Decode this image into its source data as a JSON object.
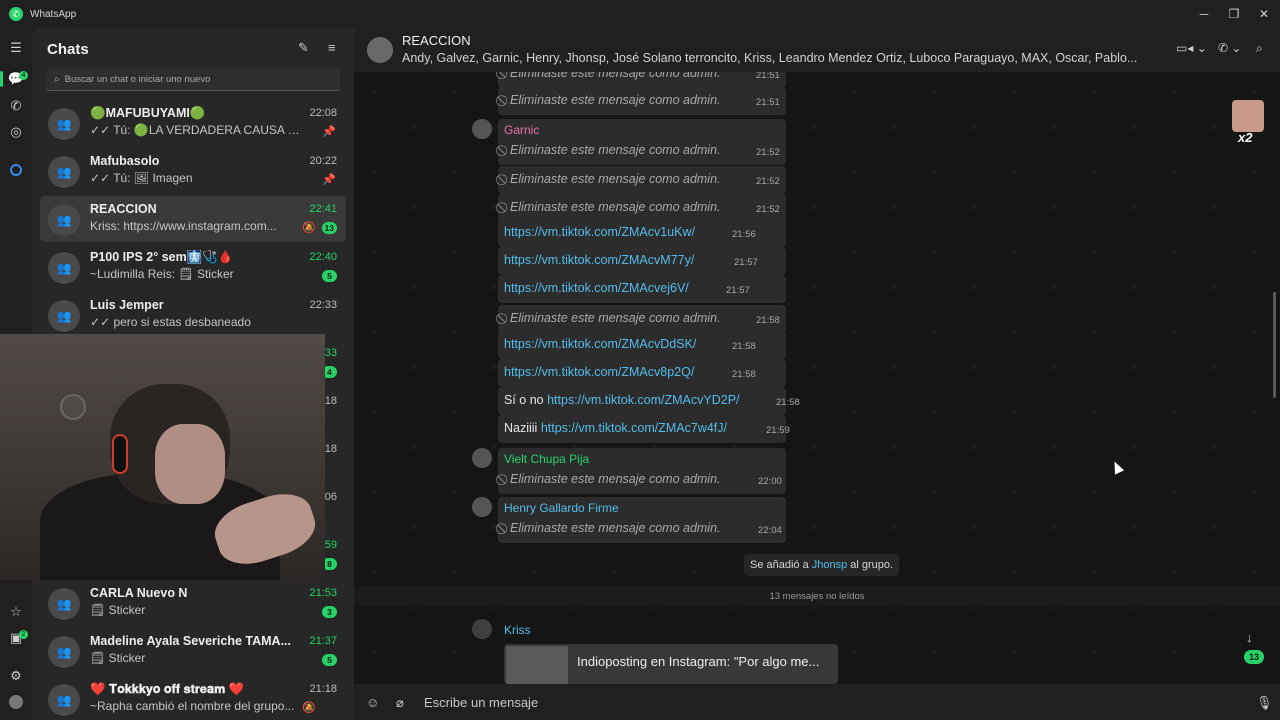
{
  "app": {
    "title": "WhatsApp"
  },
  "window": {
    "minimize_icon": "minimize-icon",
    "restore_icon": "restore-icon",
    "close_icon": "close-icon"
  },
  "rail": {
    "menu_icon": "menu-icon",
    "chats_icon": "chats-icon",
    "chats_badge": "4",
    "calls_icon": "calls-icon",
    "status_icon": "status-icon",
    "meta_ai_icon": "meta-ai-icon",
    "starred_icon": "star-icon",
    "archived_icon": "archive-icon",
    "archived_badge": "2",
    "settings_icon": "gear-icon",
    "profile_icon": "profile-icon"
  },
  "sidebar": {
    "title": "Chats",
    "new_chat_icon": "new-chat-icon",
    "filter_icon": "filter-icon",
    "search_placeholder": "Buscar un chat o iniciar uno nuevo",
    "chats": [
      {
        "name": "🟢MAFUBUYAMI🟢",
        "time": "22:08",
        "preview": "✓✓ Tú: 🟢LA VERDADERA CAUSA DE...",
        "pinned": true
      },
      {
        "name": "Mafubasolo",
        "time": "20:22",
        "preview": "✓✓ Tú: 🖼 Imagen",
        "pinned": true
      },
      {
        "name": "REACCION",
        "time": "22:41",
        "preview": "Kriss: https://www.instagram.com...",
        "badge": "13",
        "muted": true,
        "selected": true
      },
      {
        "name": "P100 IPS 2° sem🩻🩺🩸",
        "time": "22:40",
        "preview": "~Ludimilla Reis: 🗒 Sticker",
        "badge": "5"
      },
      {
        "name": "Luis Jemper",
        "time": "22:33",
        "preview": "✓✓ pero si estas desbaneado"
      },
      {
        "name": "",
        "time": "33",
        "badge": "4"
      },
      {
        "name": "",
        "time": "18"
      },
      {
        "name": "",
        "time": "18"
      },
      {
        "name": "",
        "time": "06"
      },
      {
        "name": "",
        "time": "59",
        "badge": "8"
      },
      {
        "name": "CARLA Nuevo N",
        "time": "21:53",
        "preview": "🗒 Sticker",
        "badge": "3"
      },
      {
        "name": "Madeline Ayala Severiche TAMA...",
        "time": "21:37",
        "preview": "🗒 Sticker",
        "badge": "5"
      },
      {
        "name": "❤️ 𝐓𝐨𝐤𝐤𝐤𝐲𝐨 𝐨𝐟𝐟 𝐬𝐭𝐫𝐞𝐚𝐦 ❤️",
        "time": "21:18",
        "preview": "~Rapha cambió el nombre del grupo...",
        "muted": true
      }
    ]
  },
  "header": {
    "group_name": "REACCION",
    "members": "Andy, Galvez, Garnic, Henry, Jhonsp, José Solano terroncito, Kriss, Leandro Mendez Ortiz, Luboco Paraguayo, MAX, Oscar, Pablo...",
    "video_icon": "video-call-icon",
    "voice_icon": "voice-call-icon",
    "search_icon": "search-icon"
  },
  "messages": {
    "deleted_text": "Eliminaste este mensaje como admin.",
    "items": [
      {
        "time": "21:51"
      },
      {
        "time": "21:51"
      },
      {
        "sender": "Garnic",
        "time": "21:52"
      },
      {
        "time": "21:52"
      },
      {
        "time": "21:52"
      },
      {
        "link": "https://vm.tiktok.com/ZMAcv1uKw/",
        "time": "21:56"
      },
      {
        "link": "https://vm.tiktok.com/ZMAcvM77y/",
        "time": "21:57"
      },
      {
        "link": "https://vm.tiktok.com/ZMAcvej6V/",
        "time": "21:57"
      },
      {
        "time": "21:58"
      },
      {
        "link": "https://vm.tiktok.com/ZMAcvDdSK/",
        "time": "21:58"
      },
      {
        "link": "https://vm.tiktok.com/ZMAcv8p2Q/",
        "time": "21:58"
      },
      {
        "prefix": "Sí o no",
        "link": "https://vm.tiktok.com/ZMAcvYD2P/",
        "time": "21:58"
      },
      {
        "prefix": "Naziiii",
        "link": "https://vm.tiktok.com/ZMAc7w4fJ/",
        "time": "21:59"
      },
      {
        "sender": "Vielt Chupa Pija",
        "time": "22:00"
      },
      {
        "sender": "Henry Gallardo Firme",
        "time": "22:04"
      }
    ],
    "system_prefix": "Se añadió a",
    "system_name": "Jhonsp",
    "system_suffix": "al grupo.",
    "unread_label": "13 mensajes no leídos",
    "last_sender": "Kriss",
    "link_card_title": "Indioposting en Instagram: \"Por algo me...",
    "corner_badge": "x2",
    "scroll_badge": "13"
  },
  "composer": {
    "emoji_icon": "emoji-icon",
    "attach_icon": "attach-icon",
    "placeholder": "Escribe un mensaje",
    "mic_icon": "mic-icon"
  },
  "colors": {
    "accent": "#25d366",
    "link": "#53bdeb",
    "garnic": "#e573b0",
    "vielt": "#25d366",
    "henry": "#53bdeb",
    "kriss": "#53bdeb"
  }
}
